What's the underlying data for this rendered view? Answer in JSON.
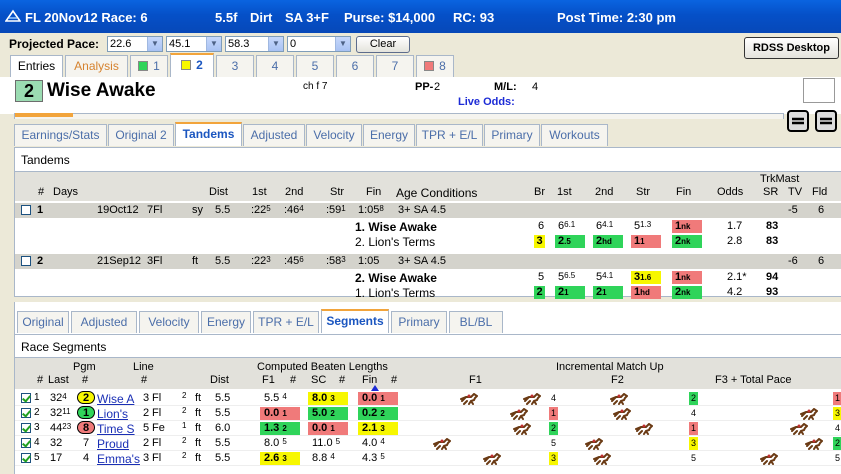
{
  "titlebar": {
    "race": "FL 20Nov12 Race: 6",
    "distance": "5.5f",
    "surface": "Dirt",
    "age_sex": "SA  3+F",
    "purse": "Purse: $14,000",
    "rc": "RC: 93",
    "post_time": "Post Time: 2:30 pm"
  },
  "pace": {
    "label": "Projected Pace:",
    "v1": "22.6",
    "v2": "45.1",
    "v3": "58.3",
    "v4": "0",
    "clear": "Clear",
    "rdss": "RDSS Desktop"
  },
  "entry_tabs": {
    "entries": "Entries",
    "analysis": "Analysis",
    "horses": [
      {
        "num": "1",
        "color": "#2fd45a"
      },
      {
        "num": "2",
        "color": "#f7f700"
      },
      {
        "num": "3",
        "color": ""
      },
      {
        "num": "4",
        "color": ""
      },
      {
        "num": "5",
        "color": ""
      },
      {
        "num": "6",
        "color": ""
      },
      {
        "num": "7",
        "color": ""
      },
      {
        "num": "8",
        "color": "#f07a7a"
      }
    ]
  },
  "horse": {
    "number": "2",
    "name": "Wise Awake",
    "desc": "ch f 7",
    "pp_label": "PP-",
    "pp": "2",
    "ml_label": "M/L:",
    "ml": "4",
    "live_odds": "Live Odds:"
  },
  "sub_tabs": [
    "Earnings/Stats",
    "Original 2",
    "Tandems",
    "Adjusted",
    "Velocity",
    "Energy",
    "TPR + E/L",
    "Primary",
    "Workouts"
  ],
  "tandems": {
    "title": "Tandems",
    "headers": {
      "num": "#",
      "days": "Days",
      "dist": "Dist",
      "first": "1st",
      "second": "2nd",
      "str": "Str",
      "fin": "Fin",
      "age": "Age Conditions",
      "br": "Br",
      "first2": "1st",
      "second2": "2nd",
      "str2": "Str",
      "fin2": "Fin",
      "odds": "Odds",
      "trk": "TrkMast",
      "sr": "SR",
      "tv": "TV",
      "fld": "Fld"
    },
    "races": [
      {
        "num": "1",
        "date": "19Oct12",
        "dist_code": "7Fl",
        "cond": "sy",
        "dist": "5.5",
        "f1": ":22",
        "f1s": "5",
        "f2": ":46",
        "f2s": "4",
        "str": ":59",
        "strs": "1",
        "fin": "1:05",
        "fins": "8",
        "age": "3+  SA 4.5",
        "tv": "-5",
        "fld": "6",
        "horses": [
          {
            "name": "1. Wise Awake",
            "br": "6",
            "p1": "6",
            "p1s": "6.1",
            "p2": "6",
            "p2s": "4.1",
            "ps": "5",
            "pss": "1.3",
            "pf": "1",
            "pfs": "nk",
            "odds": "1.7",
            "sr": "83"
          },
          {
            "name": "2. Lion's Terms",
            "br": "3",
            "p1": "2",
            "p1s": ".5",
            "p2": "2",
            "p2s": "hd",
            "ps": "1",
            "pss": "1",
            "pf": "2",
            "pfs": "nk",
            "odds": "2.8",
            "sr": "83"
          }
        ]
      },
      {
        "num": "2",
        "date": "21Sep12",
        "dist_code": "3Fl",
        "cond": "ft",
        "dist": "5.5",
        "f1": ":22",
        "f1s": "3",
        "f2": ":45",
        "f2s": "6",
        "str": ":58",
        "strs": "3",
        "fin": "1:05",
        "fins": "",
        "age": "3+  SA 4.5",
        "tv": "-6",
        "fld": "6",
        "horses": [
          {
            "name": "2. Wise Awake",
            "br": "5",
            "p1": "5",
            "p1s": "6.5",
            "p2": "5",
            "p2s": "4.1",
            "ps": "3",
            "pss": "1.6",
            "pf": "1",
            "pfs": "nk",
            "odds": "2.1*",
            "sr": "94"
          },
          {
            "name": "1. Lion's Terms",
            "br": "2",
            "p1": "2",
            "p1s": "1",
            "p2": "2",
            "p2s": "1",
            "ps": "1",
            "pss": "hd",
            "pf": "2",
            "pfs": "nk",
            "odds": "4.2",
            "sr": "93"
          }
        ]
      }
    ]
  },
  "lower_tabs": [
    "Original",
    "Adjusted",
    "Velocity",
    "Energy",
    "TPR + E/L",
    "Segments",
    "Primary",
    "BL/BL"
  ],
  "segments": {
    "title": "Race Segments",
    "headers": {
      "pgm": "Pgm",
      "line": "Line",
      "num": "#",
      "last": "Last",
      "pgm_num": "#",
      "line_num": "#",
      "dist": "Dist",
      "cbl": "Computed Beaten Lengths",
      "f1": "F1",
      "h1": "#",
      "sc": "SC",
      "h2": "#",
      "fin": "Fin",
      "h3": "#",
      "imu": "Incremental Match Up",
      "mf1": "F1",
      "mf2": "F2",
      "mf3": "F3 + Total Pace"
    },
    "rows": [
      {
        "num": "1",
        "last": "32",
        "lasts": "4",
        "pgm": "2",
        "name": "Wise A",
        "line": "3",
        "surf": "Fl",
        "lns": "2",
        "cond": "ft",
        "dist": "5.5",
        "f1": "5.5",
        "f1n": "4",
        "sc": "8.0",
        "scn": "3",
        "fin": "0.0",
        "finn": "1",
        "m1": "4",
        "m2": "2",
        "m3": "1"
      },
      {
        "num": "2",
        "last": "32",
        "lasts": "11",
        "pgm": "1",
        "name": "Lion's",
        "line": "2",
        "surf": "Fl",
        "lns": "2",
        "cond": "ft",
        "dist": "5.5",
        "f1": "0.0",
        "f1n": "1",
        "sc": "5.0",
        "scn": "2",
        "fin": "0.2",
        "finn": "2",
        "m1": "1",
        "m2": "4",
        "m3": "3"
      },
      {
        "num": "3",
        "last": "44",
        "lasts": "23",
        "pgm": "8",
        "name": "Time S",
        "line": "5",
        "surf": "Fe",
        "lns": "1",
        "cond": "ft",
        "dist": "6.0",
        "f1": "1.3",
        "f1n": "2",
        "sc": "0.0",
        "scn": "1",
        "fin": "2.1",
        "finn": "3",
        "m1": "2",
        "m2": "1",
        "m3": "4"
      },
      {
        "num": "4",
        "last": "32",
        "lasts": "",
        "pgm": "7",
        "name": "Proud",
        "line": "2",
        "surf": "Fl",
        "lns": "2",
        "cond": "ft",
        "dist": "5.5",
        "f1": "8.0",
        "f1n": "5",
        "sc": "11.0",
        "scn": "5",
        "fin": "4.0",
        "finn": "4",
        "m1": "5",
        "m2": "3",
        "m3": "2"
      },
      {
        "num": "5",
        "last": "17",
        "lasts": "",
        "pgm": "4",
        "name": "Emma's",
        "line": "3",
        "surf": "Fl",
        "lns": "2",
        "cond": "ft",
        "dist": "5.5",
        "f1": "2.6",
        "f1n": "3",
        "sc": "8.8",
        "scn": "4",
        "fin": "4.3",
        "finn": "5",
        "m1": "3",
        "m2": "5",
        "m3": "5"
      }
    ]
  },
  "colors": {
    "green": "#2fd45a",
    "red": "#f07a7a",
    "yellow": "#f7f700",
    "titlebar": "#0550c8",
    "tab_accent": "#f2a43b"
  }
}
